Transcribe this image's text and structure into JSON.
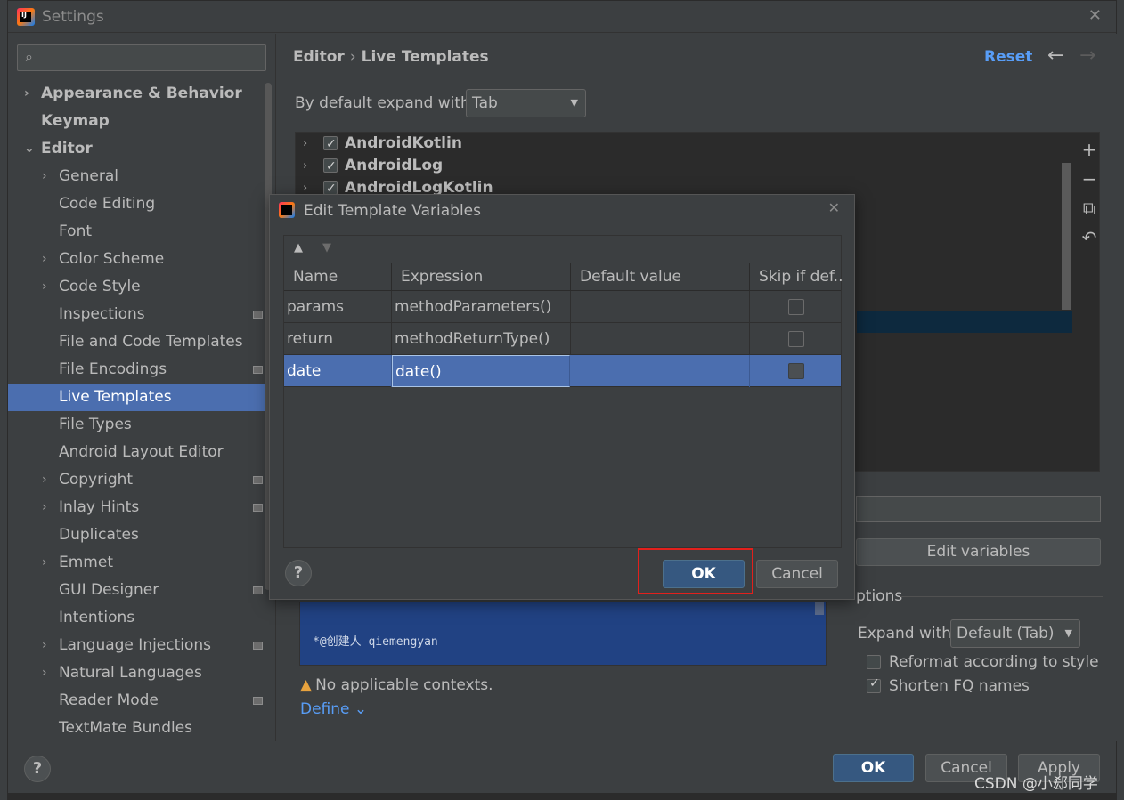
{
  "window": {
    "title": "Settings"
  },
  "sidebar": {
    "items": [
      {
        "label": "Appearance & Behavior",
        "bold": true,
        "arrow": "›",
        "level": 0
      },
      {
        "label": "Keymap",
        "bold": true,
        "arrow": "",
        "level": 0
      },
      {
        "label": "Editor",
        "bold": true,
        "arrow": "⌄",
        "level": 0
      },
      {
        "label": "General",
        "arrow": "›",
        "level": 1
      },
      {
        "label": "Code Editing",
        "arrow": "",
        "level": 1
      },
      {
        "label": "Font",
        "arrow": "",
        "level": 1
      },
      {
        "label": "Color Scheme",
        "arrow": "›",
        "level": 1
      },
      {
        "label": "Code Style",
        "arrow": "›",
        "level": 1
      },
      {
        "label": "Inspections",
        "arrow": "",
        "level": 1,
        "mark": true
      },
      {
        "label": "File and Code Templates",
        "arrow": "",
        "level": 1
      },
      {
        "label": "File Encodings",
        "arrow": "",
        "level": 1,
        "mark": true
      },
      {
        "label": "Live Templates",
        "arrow": "",
        "level": 1,
        "selected": true
      },
      {
        "label": "File Types",
        "arrow": "",
        "level": 1
      },
      {
        "label": "Android Layout Editor",
        "arrow": "",
        "level": 1
      },
      {
        "label": "Copyright",
        "arrow": "›",
        "level": 1,
        "mark": true
      },
      {
        "label": "Inlay Hints",
        "arrow": "›",
        "level": 1,
        "mark": true
      },
      {
        "label": "Duplicates",
        "arrow": "",
        "level": 1
      },
      {
        "label": "Emmet",
        "arrow": "›",
        "level": 1
      },
      {
        "label": "GUI Designer",
        "arrow": "",
        "level": 1,
        "mark": true
      },
      {
        "label": "Intentions",
        "arrow": "",
        "level": 1
      },
      {
        "label": "Language Injections",
        "arrow": "›",
        "level": 1,
        "mark": true
      },
      {
        "label": "Natural Languages",
        "arrow": "›",
        "level": 1
      },
      {
        "label": "Reader Mode",
        "arrow": "",
        "level": 1,
        "mark": true
      },
      {
        "label": "TextMate Bundles",
        "arrow": "",
        "level": 1
      }
    ]
  },
  "content": {
    "breadcrumb_1": "Editor",
    "breadcrumb_sep": "›",
    "breadcrumb_2": "Live Templates",
    "reset_label": "Reset",
    "expand_label": "By default expand with",
    "expand_value": "Tab",
    "templates": [
      "AndroidKotlin",
      "AndroidLog",
      "AndroidLogKotlin"
    ],
    "edit_variables_label": "Edit variables",
    "options_label_partial": "ptions",
    "expand_with_label": "Expand with",
    "expand_with_value": "Default (Tab)",
    "reformat_label": "Reformat according to style",
    "shorten_label": "Shorten FQ names",
    "code_line": "*@创建人 qiemengyan",
    "warning_text": "No applicable contexts.",
    "define_label": "Define"
  },
  "footer": {
    "ok_label": "OK",
    "cancel_label": "Cancel",
    "apply_label": "Apply"
  },
  "dialog": {
    "title": "Edit Template Variables",
    "columns": [
      "Name",
      "Expression",
      "Default value",
      "Skip if def..."
    ],
    "rows": [
      {
        "name": "params",
        "expression": "methodParameters()",
        "default": ""
      },
      {
        "name": "return",
        "expression": "methodReturnType()",
        "default": ""
      },
      {
        "name": "date",
        "expression": "date()",
        "default": ""
      }
    ],
    "ok_label": "OK",
    "cancel_label": "Cancel"
  },
  "watermark": "CSDN @小郄同学"
}
